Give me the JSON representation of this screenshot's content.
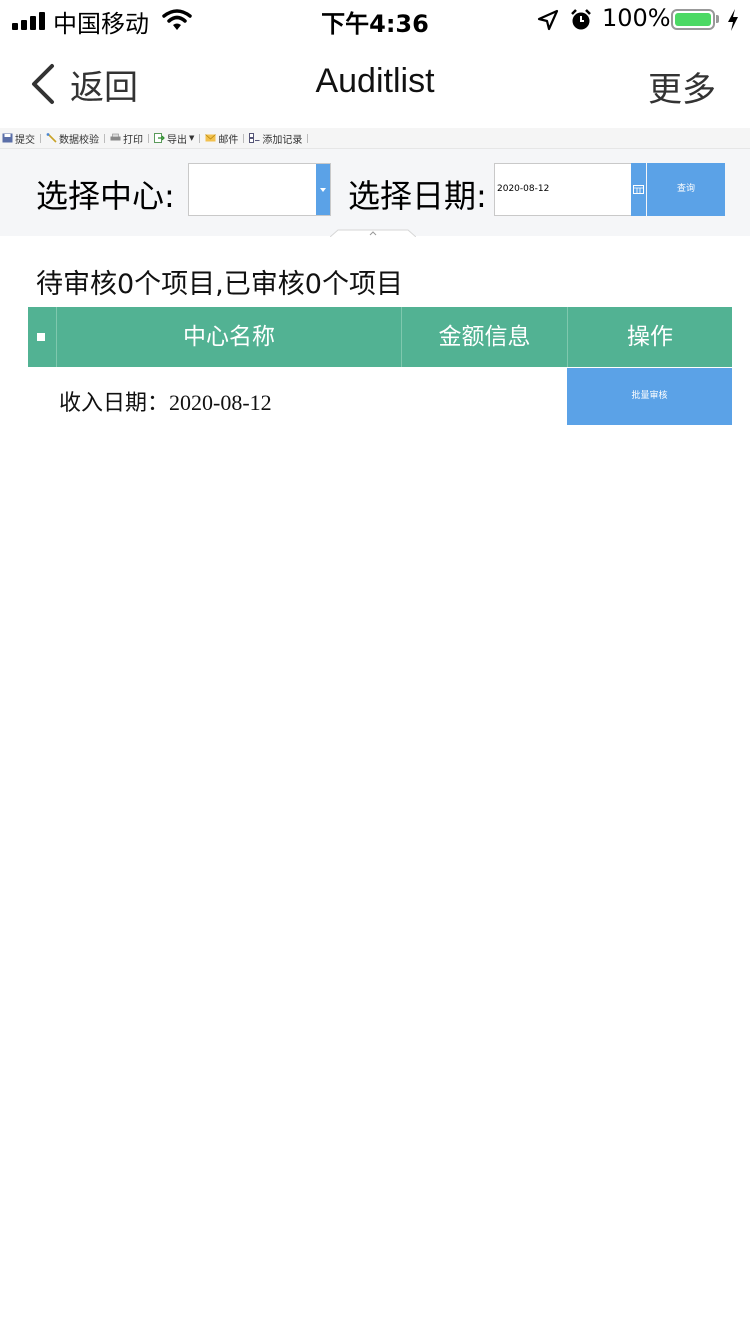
{
  "status_bar": {
    "carrier": "中国移动",
    "time": "下午4:36",
    "battery": "100%",
    "battery_color": "#4cd964"
  },
  "nav": {
    "back_label": "返回",
    "title": "Auditlist",
    "more_label": "更多"
  },
  "toolbar": {
    "items": [
      {
        "label": "提交",
        "icon": "save-icon"
      },
      {
        "label": "数据校验",
        "icon": "wand-icon"
      },
      {
        "label": "打印",
        "icon": "printer-icon"
      },
      {
        "label": "导出",
        "icon": "export-icon"
      },
      {
        "label": "邮件",
        "icon": "mail-icon"
      },
      {
        "label": "添加记录",
        "icon": "add-record-icon"
      }
    ]
  },
  "filter": {
    "center_label": "选择中心:",
    "center_value": "",
    "date_label": "选择日期:",
    "date_value": "2020-08-12",
    "query_label": "查询",
    "accent_color": "#5ba2e7"
  },
  "summary": "待审核0个项目,已审核0个项目",
  "table": {
    "header_color": "#52b293",
    "columns": [
      "中心名称",
      "金额信息",
      "操作"
    ],
    "date_row": "收入日期：2020-08-12",
    "batch_button": "批量审核"
  }
}
